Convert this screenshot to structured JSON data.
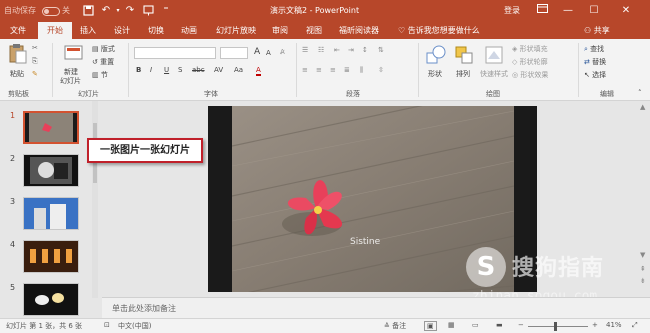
{
  "titlebar": {
    "autosave_label": "自动保存",
    "autosave_state": "关",
    "document_title": "演示文稿2  -  PowerPoint",
    "login_label": "登录",
    "quick_access": [
      "save-icon",
      "undo-icon",
      "redo-icon",
      "start-slideshow-icon",
      "customize-icon"
    ],
    "window_controls": [
      "restore-ribbon-icon",
      "minimize-icon",
      "maximize-icon",
      "close-icon"
    ]
  },
  "tabs": [
    "文件",
    "开始",
    "插入",
    "设计",
    "切换",
    "动画",
    "幻灯片放映",
    "审阅",
    "视图",
    "福昕阅读器"
  ],
  "active_tab": "开始",
  "tellme": "告诉我您想要做什么",
  "share": "共享",
  "ribbon": {
    "clipboard": {
      "paste": "粘贴",
      "group": "剪贴板"
    },
    "slides": {
      "new_slide_line1": "新建",
      "new_slide_line2": "幻灯片",
      "layout": "版式",
      "reset": "重置",
      "section": "节",
      "group": "幻灯片"
    },
    "font": {
      "group": "字体",
      "font_name": "",
      "font_size": "",
      "grow": "A",
      "shrink": "A",
      "bold": "B",
      "italic": "I",
      "underline": "U",
      "strike": "S",
      "shadow": "abc",
      "spacing": "AV",
      "case": "Aa",
      "color": "A"
    },
    "paragraph": {
      "group": "段落"
    },
    "drawing": {
      "shapes": "形状",
      "arrange": "排列",
      "quick_styles": "快速样式",
      "fill": "形状填充",
      "outline": "形状轮廓",
      "effects": "形状效果",
      "group": "绘图"
    },
    "editing": {
      "find": "查找",
      "replace": "替换",
      "select": "选择",
      "group": "编辑"
    }
  },
  "slides": [
    {
      "number": "1",
      "active": true
    },
    {
      "number": "2",
      "active": false
    },
    {
      "number": "3",
      "active": false
    },
    {
      "number": "4",
      "active": false
    },
    {
      "number": "5",
      "active": false
    }
  ],
  "callout_text": "一张图片一张幻灯片",
  "slide_caption": "Sistine",
  "notes_placeholder": "单击此处添加备注",
  "status": {
    "slide_count": "幻灯片 第 1 张，共 6 张",
    "language": "中文(中国)",
    "notes": "备注",
    "zoom": "41%"
  },
  "watermark": {
    "brand": "搜狗指南",
    "url": "zhinan.sogou.com"
  },
  "colors": {
    "accent": "#b7472a",
    "ribbon_bg": "#f3f3f3",
    "callout_border": "#c0202a",
    "flower": "#e8405a"
  }
}
